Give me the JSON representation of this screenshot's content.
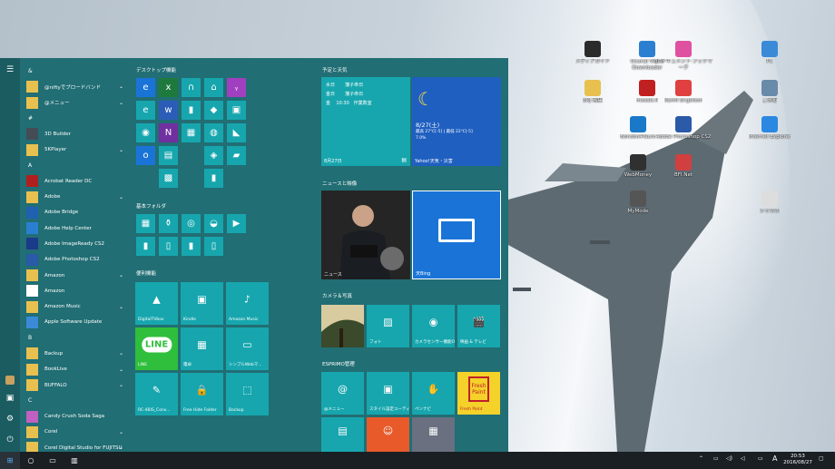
{
  "taskbar": {
    "time": "20:53",
    "date": "2016/08/27",
    "ime": "A"
  },
  "groups": {
    "desktop": "デスクトップ機能",
    "forecast": "予定と天気",
    "basic": "基本フォルダ",
    "convenience": "便利機能",
    "news": "ニュースと映像",
    "camera": "カメラ＆写真",
    "esprimo": "ESPRIMO管理"
  },
  "applist": [
    {
      "t": "letter",
      "label": "&"
    },
    {
      "label": "@niftyでブロードバンド",
      "icon": "#e8c050",
      "chev": true
    },
    {
      "label": "@メニュー",
      "icon": "#e8c050",
      "chev": true
    },
    {
      "t": "letter",
      "label": "#"
    },
    {
      "label": "3D Builder",
      "icon": "#444c55"
    },
    {
      "label": "5KPlayer",
      "icon": "#e8c050",
      "chev": true
    },
    {
      "t": "letter",
      "label": "A"
    },
    {
      "label": "Acrobat Reader DC",
      "icon": "#b02020"
    },
    {
      "label": "Adobe",
      "icon": "#e8c050",
      "chev": true
    },
    {
      "label": "Adobe Bridge",
      "icon": "#2060b0"
    },
    {
      "label": "Adobe Help Center",
      "icon": "#2a80d0"
    },
    {
      "label": "Adobe ImageReady CS2",
      "icon": "#1a3a8a"
    },
    {
      "label": "Adobe Photoshop CS2",
      "icon": "#2a5aa8"
    },
    {
      "label": "Amazon",
      "icon": "#e8c050",
      "chev": true
    },
    {
      "label": "Amazon",
      "icon": "#ffffff"
    },
    {
      "label": "Amazon Music",
      "icon": "#e8c050",
      "chev": true
    },
    {
      "label": "Apple Software Update",
      "icon": "#3a8ad8"
    },
    {
      "t": "letter",
      "label": "B"
    },
    {
      "label": "Backup",
      "icon": "#e8c050",
      "chev": true
    },
    {
      "label": "BookLive",
      "icon": "#e8c050",
      "chev": true
    },
    {
      "label": "BUFFALO",
      "icon": "#e8c050",
      "chev": true
    },
    {
      "t": "letter",
      "label": "C"
    },
    {
      "label": "Candy Crush Soda Saga",
      "icon": "#c060c0"
    },
    {
      "label": "Corel",
      "icon": "#e8c050",
      "chev": true
    },
    {
      "label": "Corel Digital Studio for FUJITSU",
      "icon": "#e8c050",
      "chev": true
    }
  ],
  "schedule": {
    "rows": [
      [
        "水日",
        "藩子命日"
      ],
      [
        "金日",
        "藩子命日"
      ],
      [
        "金",
        "10:30",
        "作業数室"
      ]
    ],
    "date": "8月27日"
  },
  "weather": {
    "date": "8/27(土)",
    "l1": "最高 27℃[-5] | 最低 22℃[-5]",
    "l2": "7.0%",
    "label": "Yahoo!天気・災害"
  },
  "tiles_big": {
    "news": "ニュース",
    "bing": "天Bing"
  },
  "camera": [
    "フォト",
    "カメラセンサー機能ON／OFFラ...",
    "映画 & テレビ"
  ],
  "convenience": [
    "DigitalTVbox",
    "Kindle",
    "Amazon Music",
    "LINE",
    "電卓",
    "シンプルWebマ...",
    "RC-4BIS_Conv...",
    "Free Hide Folder",
    "Backup"
  ],
  "esprimo": [
    "@メニュー",
    "スタイル設定ユーティリティ",
    "ペンナビ",
    "Fresh Paint"
  ],
  "tile_glyphs": {
    "line": "LINE",
    "fresh": "Fresh Paint"
  },
  "desktop_icons": [
    {
      "label": "メディアガイド",
      "c": "#2b2b2b"
    },
    {
      "label": "Ocunal Video Downloader",
      "c": "#2a7fd0"
    },
    {
      "label": "3 ·ドキュメント·ブックマーク",
      "c": "#e050a0"
    },
    {
      "label": "PC",
      "c": "#3a8ad8"
    },
    {
      "label": "BKJ 画集",
      "c": "#e8c050"
    },
    {
      "label": "mosaic:ll",
      "c": "#c02020"
    },
    {
      "label": "Kamil Engelson",
      "c": "#e04040"
    },
    {
      "label": "ごみ箱",
      "c": "#6a8aaa"
    },
    {
      "label": "Bonobo4Tauro",
      "c": "#1a78c8"
    },
    {
      "label": "Adobe Photoshop CS2",
      "c": "#2a5aa8"
    },
    {
      "label": "Internet Explorer",
      "c": "#2a88e0"
    },
    {
      "label": "WebMoney",
      "c": "#303030"
    },
    {
      "label": "BFI:Net",
      "c": "#d04040"
    },
    {
      "label": "MyMode",
      "c": "#555"
    },
    {
      "label": "シャネル",
      "c": "#ddd"
    }
  ]
}
